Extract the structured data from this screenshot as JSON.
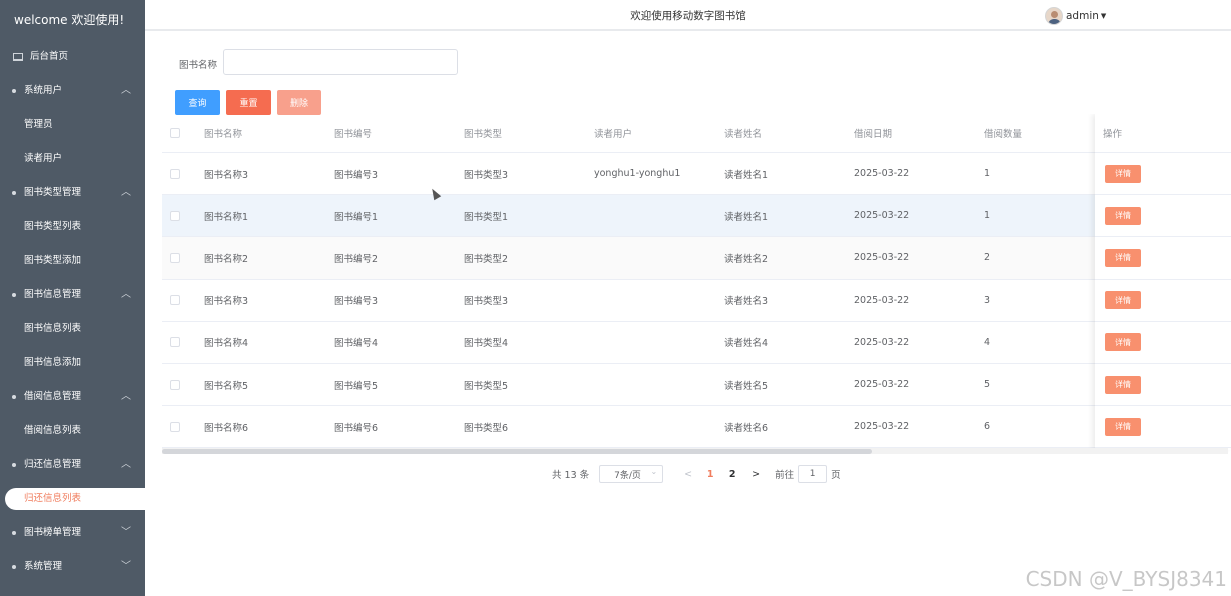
{
  "app": {
    "brand": "welcome 欢迎使用!",
    "title": "欢迎使用移动数字图书馆",
    "user": "admin"
  },
  "sidebar": {
    "items": [
      {
        "label": "后台首页",
        "kind": "home"
      },
      {
        "label": "系统用户",
        "kind": "top",
        "chevron": "^"
      },
      {
        "label": "管理员",
        "kind": "sub"
      },
      {
        "label": "读者用户",
        "kind": "sub"
      },
      {
        "label": "图书类型管理",
        "kind": "top",
        "chevron": "^"
      },
      {
        "label": "图书类型列表",
        "kind": "sub"
      },
      {
        "label": "图书类型添加",
        "kind": "sub"
      },
      {
        "label": "图书信息管理",
        "kind": "top",
        "chevron": "^"
      },
      {
        "label": "图书信息列表",
        "kind": "sub"
      },
      {
        "label": "图书信息添加",
        "kind": "sub"
      },
      {
        "label": "借阅信息管理",
        "kind": "top",
        "chevron": "^"
      },
      {
        "label": "借阅信息列表",
        "kind": "sub"
      },
      {
        "label": "归还信息管理",
        "kind": "top",
        "chevron": "^"
      },
      {
        "label": "归还信息列表",
        "kind": "active"
      },
      {
        "label": "图书榜单管理",
        "kind": "top",
        "chevron": "v"
      },
      {
        "label": "系统管理",
        "kind": "top",
        "chevron": "v"
      }
    ]
  },
  "search": {
    "label": "图书名称",
    "value": "",
    "query_label": "查询",
    "reset_label": "重置",
    "delete_label": "删除"
  },
  "table": {
    "columns": [
      "图书名称",
      "图书编号",
      "图书类型",
      "读者用户",
      "读者姓名",
      "借阅日期",
      "借阅数量"
    ],
    "op_header": "操作",
    "detail_label": "详情",
    "rows": [
      [
        "图书名称3",
        "图书编号3",
        "图书类型3",
        "yonghu1-yonghu1",
        "读者姓名1",
        "2025-03-22",
        "1"
      ],
      [
        "图书名称1",
        "图书编号1",
        "图书类型1",
        "",
        "读者姓名1",
        "2025-03-22",
        "1"
      ],
      [
        "图书名称2",
        "图书编号2",
        "图书类型2",
        "",
        "读者姓名2",
        "2025-03-22",
        "2"
      ],
      [
        "图书名称3",
        "图书编号3",
        "图书类型3",
        "",
        "读者姓名3",
        "2025-03-22",
        "3"
      ],
      [
        "图书名称4",
        "图书编号4",
        "图书类型4",
        "",
        "读者姓名4",
        "2025-03-22",
        "4"
      ],
      [
        "图书名称5",
        "图书编号5",
        "图书类型5",
        "",
        "读者姓名5",
        "2025-03-22",
        "5"
      ],
      [
        "图书名称6",
        "图书编号6",
        "图书类型6",
        "",
        "读者姓名6",
        "2025-03-22",
        "6"
      ]
    ]
  },
  "pagination": {
    "total": "共 13 条",
    "page_size": "7条/页",
    "prev": "<",
    "pages": [
      "1",
      "2"
    ],
    "current": "1",
    "next": ">",
    "goto_label": "前往",
    "goto_value": "1",
    "page_unit": "页"
  },
  "watermark": "CSDN @V_BYSJ8341"
}
